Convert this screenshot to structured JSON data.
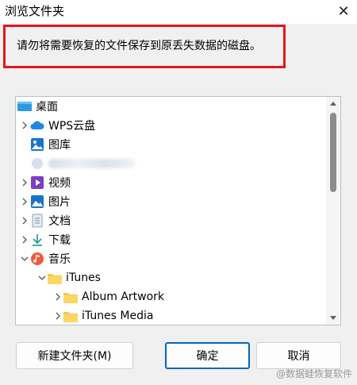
{
  "window": {
    "title": "浏览文件夹",
    "close_glyph": "✕"
  },
  "instruction": "请勿将需要恢复的文件保存到原丢失数据的磁盘。",
  "tree": {
    "desktop": "桌面",
    "wps_cloud": "WPS云盘",
    "gallery": "图库",
    "videos": "视频",
    "pictures": "图片",
    "documents": "文档",
    "downloads": "下载",
    "music": "音乐",
    "itunes": "iTunes",
    "album_artwork": "Album Artwork",
    "itunes_media": "iTunes Media"
  },
  "buttons": {
    "new_folder": "新建文件夹(M)",
    "ok": "确定",
    "cancel": "取消"
  },
  "watermark": "@数据蛙恢复软件",
  "colors": {
    "accent": "#0067c0",
    "highlight": "#e3161b",
    "folder": "#f7c84a"
  }
}
